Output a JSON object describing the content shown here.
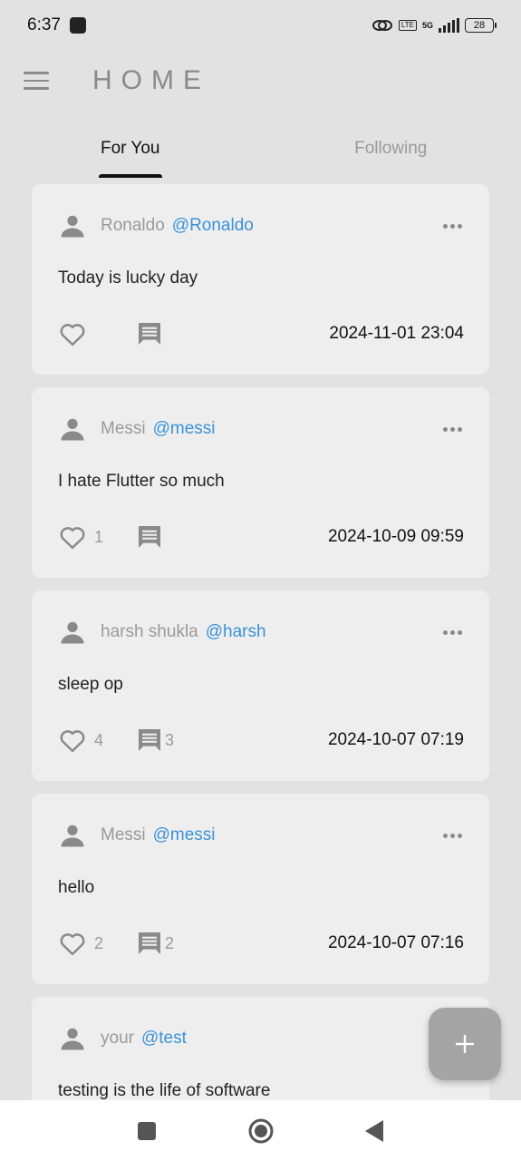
{
  "status_bar": {
    "time": "6:37",
    "network_tag": "LTE",
    "network_gen": "5G",
    "battery": "28"
  },
  "app_bar": {
    "title": "HOME",
    "menu_icon": "hamburger-menu-icon"
  },
  "tabs": [
    {
      "label": "For You",
      "active": true
    },
    {
      "label": "Following",
      "active": false
    }
  ],
  "posts": [
    {
      "name": "Ronaldo",
      "handle": "@Ronaldo",
      "text": "Today is lucky day",
      "likes": "",
      "comments": "",
      "time": "2024-11-01 23:04"
    },
    {
      "name": "Messi",
      "handle": "@messi",
      "text": "I hate Flutter so much",
      "likes": "1",
      "comments": "",
      "time": "2024-10-09 09:59"
    },
    {
      "name": "harsh shukla",
      "handle": "@harsh",
      "text": "sleep op",
      "likes": "4",
      "comments": "3",
      "time": "2024-10-07 07:19"
    },
    {
      "name": "Messi",
      "handle": "@messi",
      "text": "hello",
      "likes": "2",
      "comments": "2",
      "time": "2024-10-07 07:16"
    },
    {
      "name": "your",
      "handle": "@test",
      "text": "testing is the life of software",
      "likes": "",
      "comments": "",
      "time": ""
    }
  ],
  "colors": {
    "background": "#e2e2e2",
    "card": "#eeeeee",
    "handle": "#3a92d8",
    "muted": "#9a9a9a",
    "fab": "#a4a4a4"
  },
  "fab": {
    "icon": "plus-icon"
  }
}
